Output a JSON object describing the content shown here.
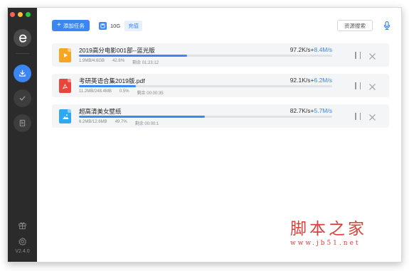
{
  "sidebar": {
    "version": "V2.4.0",
    "items": [
      {
        "name": "downloading",
        "icon": "download-icon",
        "active": true
      },
      {
        "name": "completed",
        "icon": "check-icon",
        "active": false
      },
      {
        "name": "trash",
        "icon": "archive-icon",
        "active": false
      }
    ],
    "bottom_icons": [
      "gift-icon",
      "gear-icon"
    ]
  },
  "toolbar": {
    "add_task_label": "添加任务",
    "quota_size": "10G",
    "recharge_label": "充值",
    "search_label": "资源搜索"
  },
  "tasks": [
    {
      "name": "2019高分电影001部--蓝光版",
      "size": "1.9MB/4.6GB",
      "percent": "42.8%",
      "remaining": "剩余 01:23:12",
      "down_speed": "97.2K/s",
      "plus": "+",
      "up_speed": "8.4M/s",
      "progress": 0.428,
      "icon": "video-file-icon",
      "icon_color": "#f7a623"
    },
    {
      "name": "考研英语合集2019版.pdf",
      "size": "11.2MB/248.4MB",
      "percent": "0.5%",
      "remaining": "剩余 00:00:35",
      "down_speed": "92.1K/s",
      "plus": "+",
      "up_speed": "6.2M/s",
      "progress": 0.225,
      "icon": "pdf-file-icon",
      "icon_color": "#e8453c"
    },
    {
      "name": "超高清美女壁纸",
      "size": "6.2MB/12.6MB",
      "percent": "49.7%",
      "remaining": "剩余 00:00:1",
      "down_speed": "82.7K/s",
      "plus": "+",
      "up_speed": "5.7M/s",
      "progress": 0.497,
      "icon": "image-file-icon",
      "icon_color": "#2ea8f0"
    }
  ],
  "watermark": {
    "title": "脚本之家",
    "url": "www.jb51.net"
  },
  "colors": {
    "accent": "#3b86f2",
    "sidebar_bg": "#2b2b2b"
  }
}
